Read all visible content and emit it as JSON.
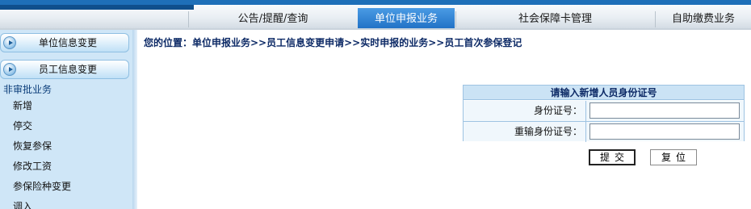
{
  "nav": {
    "tabs": [
      {
        "label": "公告/提醒/查询"
      },
      {
        "label": "单位申报业务"
      },
      {
        "label": "社会保障卡管理"
      },
      {
        "label": "自助缴费业务"
      }
    ],
    "active_index": 1
  },
  "sidebar": {
    "buttons": [
      {
        "label": "单位信息变更"
      },
      {
        "label": "员工信息变更"
      }
    ],
    "section_title": "非审批业务",
    "links": [
      {
        "label": "新增"
      },
      {
        "label": "停交"
      },
      {
        "label": "恢复参保"
      },
      {
        "label": "修改工资"
      },
      {
        "label": "参保险种变更"
      },
      {
        "label": "调入"
      }
    ]
  },
  "breadcrumb": "您的位置：单位申报业务>>员工信息变更申请>>实时申报的业务>>员工首次参保登记",
  "form": {
    "title": "请输入新增人员身份证号",
    "id_label": "身份证号：",
    "id_value": "",
    "reid_label": "重输身份证号：",
    "reid_value": ""
  },
  "buttons": {
    "submit": "提交",
    "reset": "复位"
  },
  "colors": {
    "nav_active": "#1f6fc4",
    "sidebar_bg": "#cfe6f7",
    "breadcrumb_text": "#0d2a66",
    "form_header_bg": "#cbe3f5"
  }
}
